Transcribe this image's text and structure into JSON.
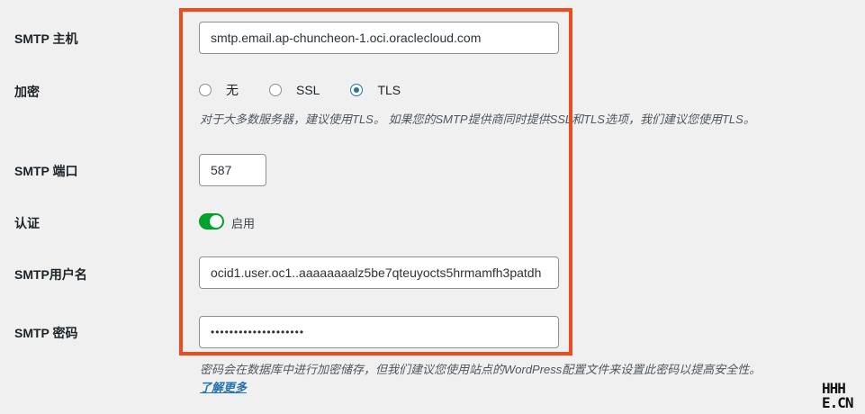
{
  "fields": {
    "host": {
      "label": "SMTP 主机",
      "value": "smtp.email.ap-chuncheon-1.oci.oraclecloud.com"
    },
    "encryption": {
      "label": "加密",
      "options": [
        {
          "label": "无",
          "checked": false
        },
        {
          "label": "SSL",
          "checked": false
        },
        {
          "label": "TLS",
          "checked": true
        }
      ],
      "description": "对于大多数服务器，建议使用TLS。 如果您的SMTP提供商同时提供SSL和TLS选项，我们建议您使用TLS。"
    },
    "port": {
      "label": "SMTP 端口",
      "value": "587"
    },
    "auth": {
      "label": "认证",
      "toggle_label": "启用",
      "enabled": true
    },
    "username": {
      "label": "SMTP用户名",
      "value": "ocid1.user.oc1..aaaaaaaalz5be7qteuyocts5hrmamfh3patdh"
    },
    "password": {
      "label": "SMTP 密码",
      "value": "••••••••••••••••••••",
      "description": "密码会在数据库中进行加密储存，但我们建议您使用站点的WordPress配置文件来设置此密码以提高安全性。",
      "learn_more": "了解更多"
    }
  },
  "watermark": {
    "line1": "HHH",
    "line2": "E.CN"
  },
  "colors": {
    "highlight": "#f14a1c",
    "accent": "#2271b1",
    "toggle_on": "#00a32a"
  }
}
